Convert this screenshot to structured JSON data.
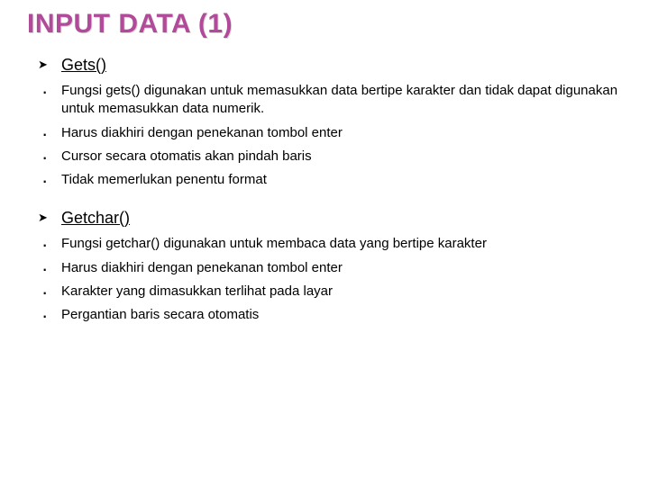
{
  "title": "INPUT DATA (1)",
  "section1": {
    "heading": "Gets()",
    "items": [
      "Fungsi gets() digunakan untuk memasukkan data bertipe karakter dan tidak dapat digunakan untuk memasukkan data numerik.",
      "Harus diakhiri dengan penekanan tombol enter",
      "Cursor secara otomatis akan pindah baris",
      "Tidak memerlukan penentu format"
    ]
  },
  "section2": {
    "heading": "Getchar()",
    "items": [
      "Fungsi getchar() digunakan untuk membaca data yang bertipe karakter",
      "Harus diakhiri dengan penekanan tombol enter",
      "Karakter yang dimasukkan terlihat pada layar",
      " Pergantian baris secara otomatis"
    ]
  }
}
